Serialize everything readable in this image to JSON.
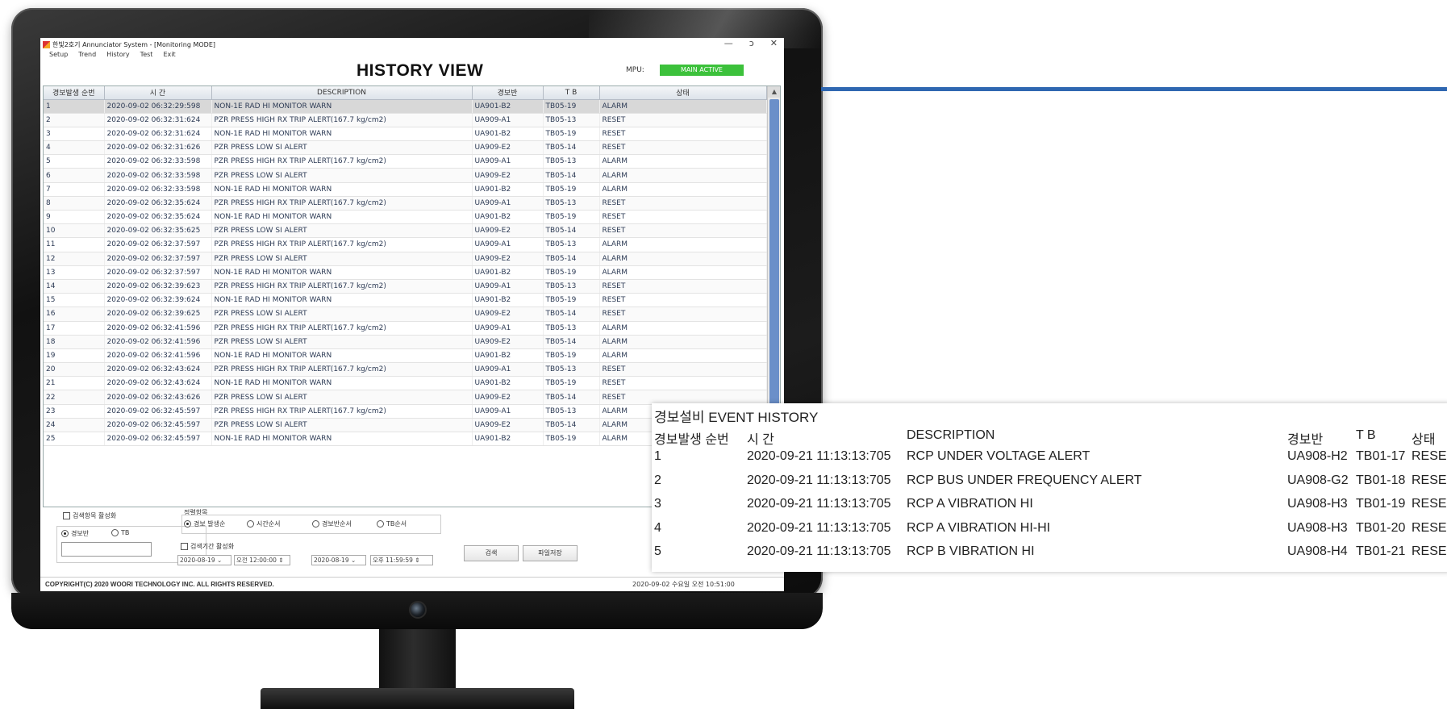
{
  "app": {
    "window_title": "한빛2호기 Annunciator System - [Monitoring MODE]",
    "menu": [
      "Setup",
      "Trend",
      "History",
      "Test",
      "Exit"
    ],
    "win_controls": [
      "—",
      "ɔ",
      "✕"
    ]
  },
  "history_view": {
    "title": "HISTORY VIEW",
    "mpu_label": "MPU:",
    "mpu_status": "MAIN ACTIVE",
    "mpu_status_color": "#3cc13b",
    "columns": [
      "경보발생 순번",
      "시     간",
      "DESCRIPTION",
      "경보반",
      "T B",
      "상태"
    ],
    "rows": [
      [
        "1",
        "2020-09-02 06:32:29:598",
        "NON-1E RAD HI MONITOR WARN",
        "UA901-B2",
        "TB05-19",
        "ALARM"
      ],
      [
        "2",
        "2020-09-02 06:32:31:624",
        "PZR PRESS HIGH RX TRIP ALERT(167.7 kg/cm2)",
        "UA909-A1",
        "TB05-13",
        "RESET"
      ],
      [
        "3",
        "2020-09-02 06:32:31:624",
        "NON-1E RAD HI MONITOR WARN",
        "UA901-B2",
        "TB05-19",
        "RESET"
      ],
      [
        "4",
        "2020-09-02 06:32:31:626",
        "PZR PRESS LOW SI ALERT",
        "UA909-E2",
        "TB05-14",
        "RESET"
      ],
      [
        "5",
        "2020-09-02 06:32:33:598",
        "PZR PRESS HIGH RX TRIP ALERT(167.7 kg/cm2)",
        "UA909-A1",
        "TB05-13",
        "ALARM"
      ],
      [
        "6",
        "2020-09-02 06:32:33:598",
        "PZR PRESS LOW SI ALERT",
        "UA909-E2",
        "TB05-14",
        "ALARM"
      ],
      [
        "7",
        "2020-09-02 06:32:33:598",
        "NON-1E RAD HI MONITOR WARN",
        "UA901-B2",
        "TB05-19",
        "ALARM"
      ],
      [
        "8",
        "2020-09-02 06:32:35:624",
        "PZR PRESS HIGH RX TRIP ALERT(167.7 kg/cm2)",
        "UA909-A1",
        "TB05-13",
        "RESET"
      ],
      [
        "9",
        "2020-09-02 06:32:35:624",
        "NON-1E RAD HI MONITOR WARN",
        "UA901-B2",
        "TB05-19",
        "RESET"
      ],
      [
        "10",
        "2020-09-02 06:32:35:625",
        "PZR PRESS LOW SI ALERT",
        "UA909-E2",
        "TB05-14",
        "RESET"
      ],
      [
        "11",
        "2020-09-02 06:32:37:597",
        "PZR PRESS HIGH RX TRIP ALERT(167.7 kg/cm2)",
        "UA909-A1",
        "TB05-13",
        "ALARM"
      ],
      [
        "12",
        "2020-09-02 06:32:37:597",
        "PZR PRESS LOW SI ALERT",
        "UA909-E2",
        "TB05-14",
        "ALARM"
      ],
      [
        "13",
        "2020-09-02 06:32:37:597",
        "NON-1E RAD HI MONITOR WARN",
        "UA901-B2",
        "TB05-19",
        "ALARM"
      ],
      [
        "14",
        "2020-09-02 06:32:39:623",
        "PZR PRESS HIGH RX TRIP ALERT(167.7 kg/cm2)",
        "UA909-A1",
        "TB05-13",
        "RESET"
      ],
      [
        "15",
        "2020-09-02 06:32:39:624",
        "NON-1E RAD HI MONITOR WARN",
        "UA901-B2",
        "TB05-19",
        "RESET"
      ],
      [
        "16",
        "2020-09-02 06:32:39:625",
        "PZR PRESS LOW SI ALERT",
        "UA909-E2",
        "TB05-14",
        "RESET"
      ],
      [
        "17",
        "2020-09-02 06:32:41:596",
        "PZR PRESS HIGH RX TRIP ALERT(167.7 kg/cm2)",
        "UA909-A1",
        "TB05-13",
        "ALARM"
      ],
      [
        "18",
        "2020-09-02 06:32:41:596",
        "PZR PRESS LOW SI ALERT",
        "UA909-E2",
        "TB05-14",
        "ALARM"
      ],
      [
        "19",
        "2020-09-02 06:32:41:596",
        "NON-1E RAD HI MONITOR WARN",
        "UA901-B2",
        "TB05-19",
        "ALARM"
      ],
      [
        "20",
        "2020-09-02 06:32:43:624",
        "PZR PRESS HIGH RX TRIP ALERT(167.7 kg/cm2)",
        "UA909-A1",
        "TB05-13",
        "RESET"
      ],
      [
        "21",
        "2020-09-02 06:32:43:624",
        "NON-1E RAD HI MONITOR WARN",
        "UA901-B2",
        "TB05-19",
        "RESET"
      ],
      [
        "22",
        "2020-09-02 06:32:43:626",
        "PZR PRESS LOW SI ALERT",
        "UA909-E2",
        "TB05-14",
        "RESET"
      ],
      [
        "23",
        "2020-09-02 06:32:45:597",
        "PZR PRESS HIGH RX TRIP ALERT(167.7 kg/cm2)",
        "UA909-A1",
        "TB05-13",
        "ALARM"
      ],
      [
        "24",
        "2020-09-02 06:32:45:597",
        "PZR PRESS LOW SI ALERT",
        "UA909-E2",
        "TB05-14",
        "ALARM"
      ],
      [
        "25",
        "2020-09-02 06:32:45:597",
        "NON-1E RAD HI MONITOR WARN",
        "UA901-B2",
        "TB05-19",
        "ALARM"
      ]
    ]
  },
  "controls": {
    "search_enable_label": "검색항목 활성화",
    "radio_panel_label": "경보반",
    "radio_tb_label": "TB",
    "sort_group_label": "정렬항목",
    "sort_options": [
      "경보 발생순",
      "시간순서",
      "경보반순서",
      "TB순서"
    ],
    "period_enable_label": "검색기간 활성화",
    "start_date": "2020-08-19",
    "start_time": "오전 12:00:00",
    "end_date": "2020-08-19",
    "end_time": "오후 11:59:59",
    "search_button": "검색",
    "save_button": "파일저장"
  },
  "footer": {
    "copyright": "COPYRIGHT(C) 2020 WOORI TECHNOLOGY INC. ALL RIGHTS RESERVED.",
    "datetime": "2020-09-02 수요일 오전 10:51:00"
  },
  "event_history": {
    "title": "경보설비 EVENT HISTORY",
    "columns": [
      "경보발생 순번",
      "시   간",
      "DESCRIPTION",
      "경보반",
      "T B",
      "상태"
    ],
    "rows": [
      [
        "1",
        "2020-09-21 11:13:13:705",
        "RCP UNDER VOLTAGE ALERT",
        "UA908-H2",
        "TB01-17",
        "RESET"
      ],
      [
        "2",
        "2020-09-21 11:13:13:705",
        "RCP BUS UNDER FREQUENCY ALERT",
        "UA908-G2",
        "TB01-18",
        "RESET"
      ],
      [
        "3",
        "2020-09-21 11:13:13:705",
        "RCP A VIBRATION HI",
        "UA908-H3",
        "TB01-19",
        "RESET"
      ],
      [
        "4",
        "2020-09-21 11:13:13:705",
        "RCP A VIBRATION HI-HI",
        "UA908-H3",
        "TB01-20",
        "RESET"
      ],
      [
        "5",
        "2020-09-21 11:13:13:705",
        "RCP B VIBRATION HI",
        "UA908-H4",
        "TB01-21",
        "RESET"
      ]
    ]
  },
  "colors": {
    "callout_line": "#2f67b1",
    "scroll_thumb": "#6b8fc9"
  }
}
